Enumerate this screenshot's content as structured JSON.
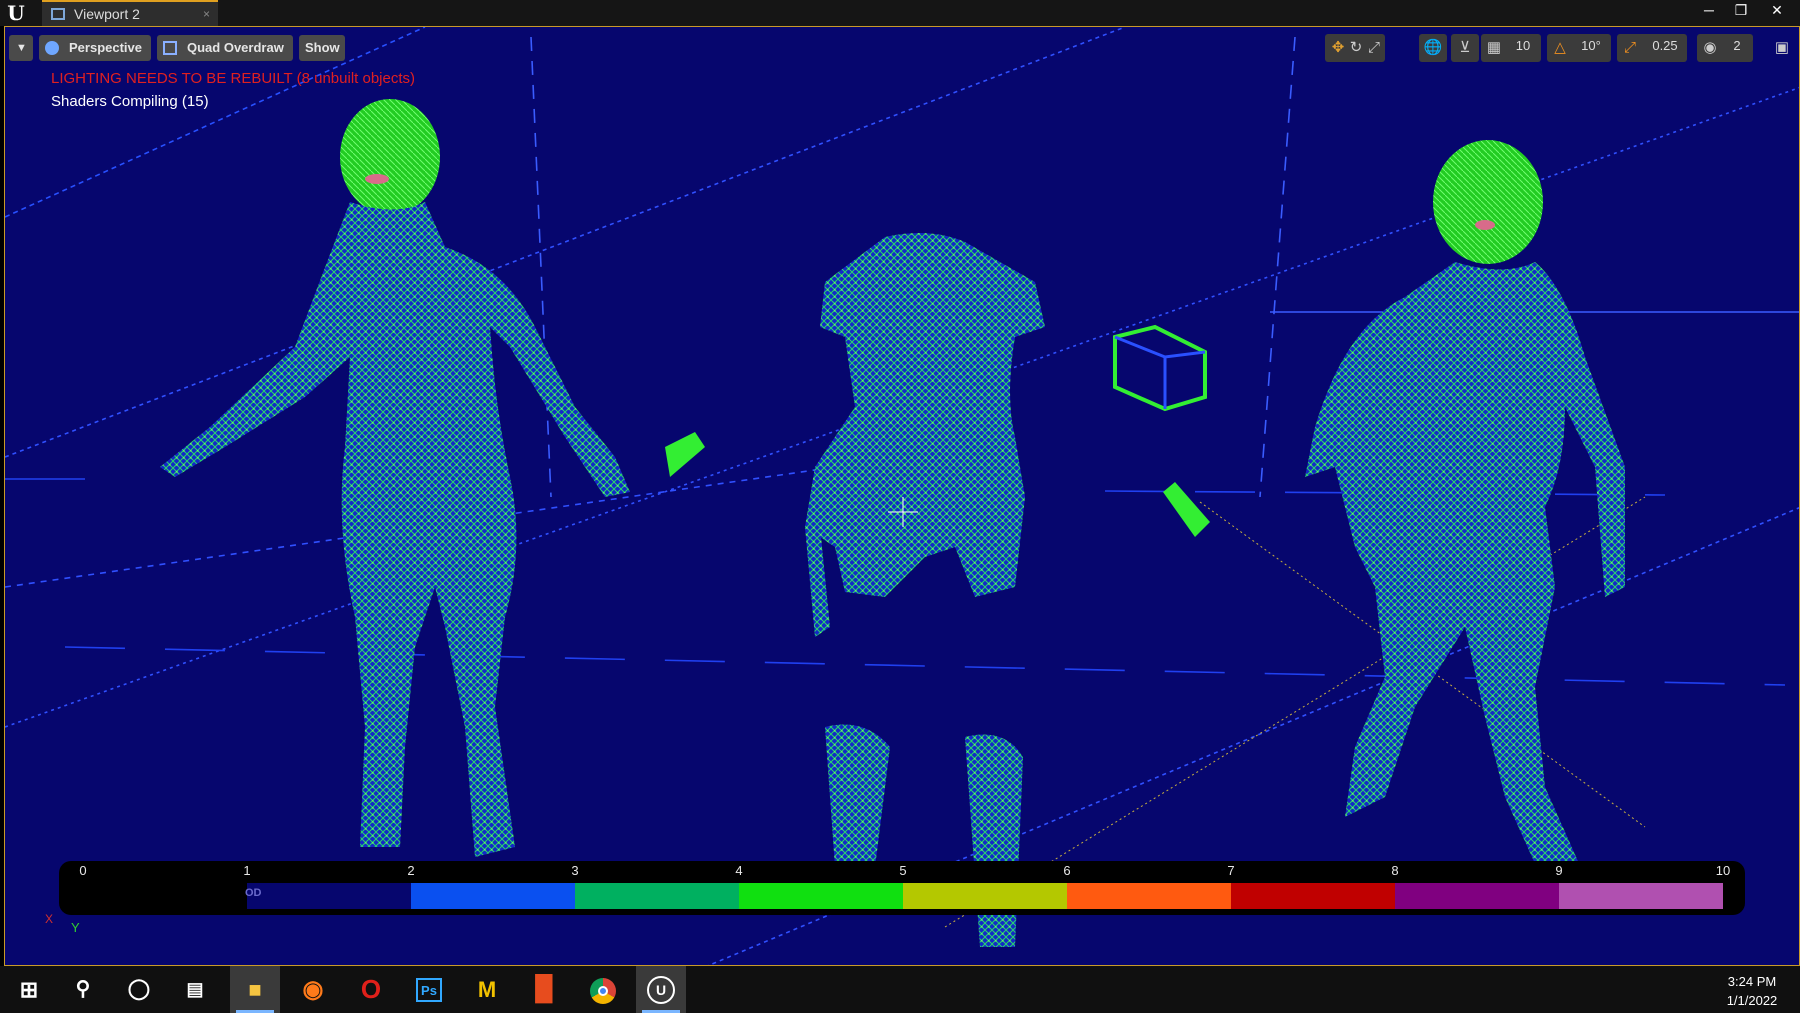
{
  "window": {
    "app_icon": "unreal-engine-logo",
    "tab_title": "Viewport 2",
    "tab_close": "×"
  },
  "toolbar": {
    "options_icon": "dropdown-arrow-icon",
    "perspective_label": "Perspective",
    "view_mode_label": "Quad Overdraw",
    "show_label": "Show",
    "grid_snap_value": "10",
    "rotation_snap_value": "10°",
    "scale_snap_value": "0.25",
    "camera_speed_value": "2"
  },
  "messages": {
    "lighting_warning": "LIGHTING NEEDS TO BE REBUILT (8 unbuilt objects)",
    "shaders_compiling": "Shaders Compiling (15)"
  },
  "legend": {
    "labels": [
      "0",
      "1",
      "2",
      "3",
      "4",
      "5",
      "6",
      "7",
      "8",
      "9",
      "10"
    ],
    "od_label": "OD",
    "colors": [
      "#06066e",
      "#0a50f0",
      "#00b060",
      "#10e010",
      "#b4c800",
      "#ff5a10",
      "#c00000",
      "#800080",
      "#b050b0",
      "#ffe0e0"
    ]
  },
  "axis": {
    "x": "X",
    "y": "Y"
  },
  "taskbar": {
    "apps": [
      "windows-start",
      "search",
      "cortana",
      "task-view",
      "file-explorer",
      "firefox",
      "opera",
      "photoshop",
      "unknown-m-app",
      "office",
      "chrome",
      "unreal-engine"
    ],
    "ps_label": "Ps",
    "m_label": "M",
    "time": "3:24 PM",
    "date": "1/1/2022"
  }
}
